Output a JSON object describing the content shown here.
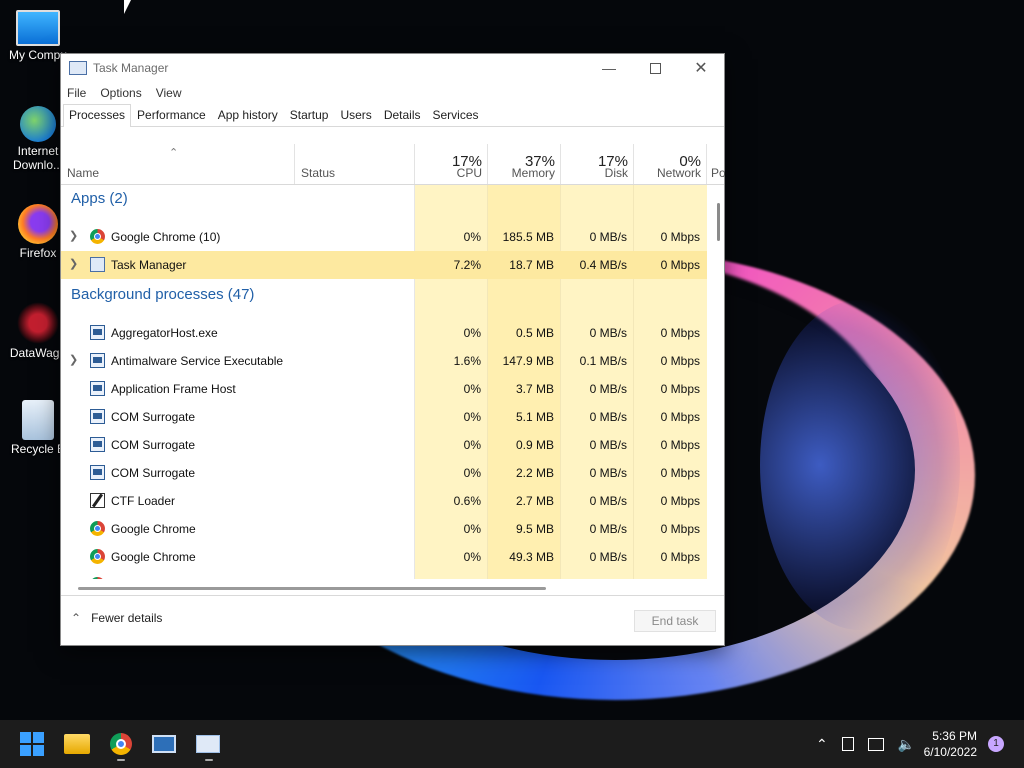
{
  "desktop": {
    "icons": [
      {
        "label": "My Compu"
      },
      {
        "label": "Internet\nDownlo..."
      },
      {
        "label": "Firefox"
      },
      {
        "label": "DataWago"
      },
      {
        "label": "Recycle B"
      }
    ]
  },
  "window": {
    "title": "Task Manager",
    "menu": [
      "File",
      "Options",
      "View"
    ],
    "tabs": [
      "Processes",
      "Performance",
      "App history",
      "Startup",
      "Users",
      "Details",
      "Services"
    ],
    "active_tab": "Processes",
    "columns": {
      "name": "Name",
      "status": "Status",
      "cpu": {
        "pct": "17%",
        "label": "CPU"
      },
      "memory": {
        "pct": "37%",
        "label": "Memory"
      },
      "disk": {
        "pct": "17%",
        "label": "Disk"
      },
      "network": {
        "pct": "0%",
        "label": "Network"
      },
      "power": {
        "label": "Po"
      }
    },
    "groups": {
      "apps": "Apps (2)",
      "background": "Background processes (47)"
    },
    "rows": [
      {
        "name": "Google Chrome (10)",
        "icon": "chrome-icon",
        "expand": true,
        "cpu": "0%",
        "mem": "185.5 MB",
        "disk": "0 MB/s",
        "net": "0 Mbps"
      },
      {
        "name": "Task Manager",
        "icon": "task-manager-icon",
        "expand": true,
        "cpu": "7.2%",
        "mem": "18.7 MB",
        "disk": "0.4 MB/s",
        "net": "0 Mbps"
      },
      {
        "name": "AggregatorHost.exe",
        "icon": "process-icon",
        "expand": false,
        "cpu": "0%",
        "mem": "0.5 MB",
        "disk": "0 MB/s",
        "net": "0 Mbps"
      },
      {
        "name": "Antimalware Service Executable",
        "icon": "process-icon",
        "expand": true,
        "cpu": "1.6%",
        "mem": "147.9 MB",
        "disk": "0.1 MB/s",
        "net": "0 Mbps"
      },
      {
        "name": "Application Frame Host",
        "icon": "process-icon",
        "expand": false,
        "cpu": "0%",
        "mem": "3.7 MB",
        "disk": "0 MB/s",
        "net": "0 Mbps"
      },
      {
        "name": "COM Surrogate",
        "icon": "process-icon",
        "expand": false,
        "cpu": "0%",
        "mem": "5.1 MB",
        "disk": "0 MB/s",
        "net": "0 Mbps"
      },
      {
        "name": "COM Surrogate",
        "icon": "process-icon",
        "expand": false,
        "cpu": "0%",
        "mem": "0.9 MB",
        "disk": "0 MB/s",
        "net": "0 Mbps"
      },
      {
        "name": "COM Surrogate",
        "icon": "process-icon",
        "expand": false,
        "cpu": "0%",
        "mem": "2.2 MB",
        "disk": "0 MB/s",
        "net": "0 Mbps"
      },
      {
        "name": "CTF Loader",
        "icon": "ctf-loader-icon",
        "expand": false,
        "cpu": "0.6%",
        "mem": "2.7 MB",
        "disk": "0 MB/s",
        "net": "0 Mbps"
      },
      {
        "name": "Google Chrome",
        "icon": "chrome-icon",
        "expand": false,
        "cpu": "0%",
        "mem": "9.5 MB",
        "disk": "0 MB/s",
        "net": "0 Mbps"
      },
      {
        "name": "Google Chrome",
        "icon": "chrome-icon",
        "expand": false,
        "cpu": "0%",
        "mem": "49.3 MB",
        "disk": "0 MB/s",
        "net": "0 Mbps"
      }
    ],
    "footer": {
      "fewer_details": "Fewer details",
      "end_task": "End task"
    }
  },
  "taskbar": {
    "time": "5:36 PM",
    "date": "6/10/2022",
    "notification_count": "1"
  }
}
